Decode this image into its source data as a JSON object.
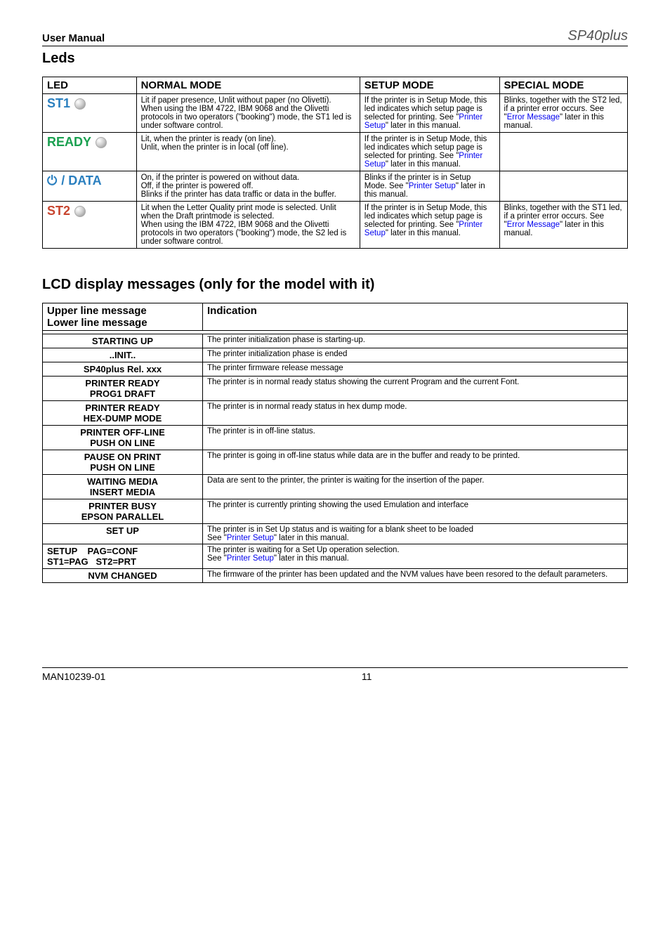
{
  "header": {
    "left": "User Manual",
    "logo": "SP40plus"
  },
  "sections": {
    "leds": "Leds",
    "lcd": "LCD display messages (only for the model with it)"
  },
  "leds_table": {
    "headers": {
      "led": "LED",
      "normal": "NORMAL MODE",
      "setup": "SETUP MODE",
      "special": "SPECIAL MODE"
    },
    "rows": [
      {
        "label": "ST1",
        "class": "st1",
        "normal": "Lit if paper presence, Unlit without paper (no Olivetti).\nWhen using the IBM 4722, IBM 9068 and the Olivetti protocols in two operators (\"booking\") mode, the ST1 led is under software control.",
        "setup_pre": "If the printer is in Setup Mode, this led indicates which setup page is selected for printing. See \"",
        "setup_link": "Printer Setup",
        "setup_post": "\" later in this manual.",
        "special_pre": "Blinks, together with the ST2 led, if a printer error occurs. See \"",
        "special_link": "Error Message",
        "special_post": "\" later in this manual."
      },
      {
        "label": "READY",
        "class": "ready",
        "normal": "Lit, when the printer is ready (on line).\nUnlit, when the printer is in local (off line).",
        "setup_pre": "If the printer is in Setup Mode, this led indicates which setup page is selected for printing. See \"",
        "setup_link": "Printer Setup",
        "setup_post": "\" later in this manual.",
        "special_pre": "",
        "special_link": "",
        "special_post": ""
      },
      {
        "label": "/ DATA",
        "class": "data",
        "normal": "On, if the printer is powered on without data.\nOff, if the printer is powered off.\nBlinks if the printer has data traffic or data in the buffer.",
        "setup_pre": "Blinks if the printer is in Setup Mode. See \"",
        "setup_link": "Printer Setup",
        "setup_post": "\" later in this manual.",
        "special_pre": "",
        "special_link": "",
        "special_post": ""
      },
      {
        "label": "ST2",
        "class": "st2",
        "normal": "Lit when the Letter Quality print mode is selected. Unlit  when the Draft printmode is selected.\nWhen using the IBM 4722, IBM 9068 and the Olivetti protocols in two operators (\"booking\") mode, the S2 led is under software control.",
        "setup_pre": "If the printer is in Setup Mode, this led indicates which setup page is selected for printing. See \"",
        "setup_link": "Printer Setup",
        "setup_post": "\" later in this manual.",
        "special_pre": "Blinks, together with the ST1 led, if a printer error occurs. See \"",
        "special_link": "Error Message",
        "special_post": "\" later in this manual."
      }
    ]
  },
  "lcd_table": {
    "headers": {
      "msg1": "Upper line message",
      "msg2": "Lower line message",
      "ind": "Indication"
    },
    "rows": [
      {
        "u": "STARTING UP",
        "l": "",
        "ind": "The printer initialization phase is starting-up."
      },
      {
        "u": "..INIT..",
        "l": "",
        "ind": "The printer initialization phase is ended"
      },
      {
        "u": "SP40plus  Rel. xxx",
        "l": "",
        "ind": "The printer firmware release message"
      },
      {
        "u": "PRINTER READY",
        "l": "PROG1       DRAFT",
        "ind": "The printer is in normal  ready status showing the current Program and the current Font."
      },
      {
        "u": "PRINTER READY",
        "l": "HEX-DUMP  MODE",
        "ind": "The printer is in normal  ready status in hex dump mode."
      },
      {
        "u": "PRINTER OFF-LINE",
        "l": "PUSH ON LINE",
        "ind": "The printer is in off-line status."
      },
      {
        "u": "PAUSE ON PRINT",
        "l": "PUSH ON LINE",
        "ind": "The printer is going in off-line status while data are in the buffer and ready to be printed."
      },
      {
        "u": "WAITING  MEDIA",
        "l": "INSERT    MEDIA",
        "ind": "Data are sent to the printer, the printer is waiting for the insertion of the paper."
      },
      {
        "u": "PRINTER  BUSY",
        "l": "EPSON PARALLEL",
        "ind": "The printer is currently printing showing the used Emulation and interface"
      },
      {
        "u": "SET UP",
        "l": "",
        "ind_pre": "The printer is in Set Up status and is waiting for a blank sheet to be loaded\nSee \"",
        "ind_link": "Printer Setup",
        "ind_post": "\" later in this manual."
      },
      {
        "u": "SETUP    PAG=CONF",
        "l": "ST1=PAG   ST2=PRT",
        "left": true,
        "ind_pre": "The printer is waiting for a Set Up operation selection.\nSee \"",
        "ind_link": "Printer Setup",
        "ind_post": "\" later in this manual."
      },
      {
        "u": "NVM CHANGED",
        "l": "",
        "ind": "The firmware of the printer has been updated and the NVM values have been resored to the default parameters."
      }
    ]
  },
  "footer": {
    "left": "MAN10239-01",
    "center": "11"
  }
}
